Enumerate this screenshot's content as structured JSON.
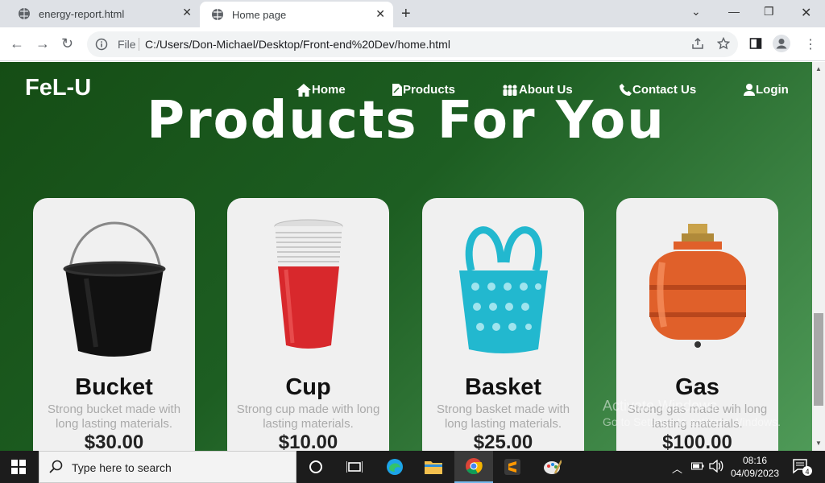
{
  "browser": {
    "tabs": [
      {
        "title": "energy-report.html",
        "active": false
      },
      {
        "title": "Home page",
        "active": true
      }
    ],
    "address": {
      "scheme_label": "File",
      "url": "C:/Users/Don-Michael/Desktop/Front-end%20Dev/home.html"
    }
  },
  "site": {
    "logo": "FeL-U",
    "nav": [
      {
        "label": "Home",
        "icon": "home-icon"
      },
      {
        "label": "Products",
        "icon": "products-icon"
      },
      {
        "label": "About Us",
        "icon": "people-icon"
      },
      {
        "label": "Contact Us",
        "icon": "phone-icon"
      },
      {
        "label": "Login",
        "icon": "user-icon"
      }
    ],
    "hero_title": "Products For You",
    "products": [
      {
        "name": "Bucket",
        "desc": "Strong bucket made with long lasting materials.",
        "price": "$30.00",
        "image": "bucket-image"
      },
      {
        "name": "Cup",
        "desc": "Strong cup made with long lasting materials.",
        "price": "$10.00",
        "image": "cup-image"
      },
      {
        "name": "Basket",
        "desc": "Strong basket made with long lasting materials.",
        "price": "$25.00",
        "image": "basket-image"
      },
      {
        "name": "Gas",
        "desc": "Strong gas made wih long lasting materials.",
        "price": "$100.00",
        "image": "gas-cylinder-image"
      }
    ],
    "colors": {
      "bg_dark": "#154d15",
      "bg_light": "#4f9a58",
      "card": "#f0f0f0"
    }
  },
  "watermark": {
    "line1": "Activate Windows",
    "line2": "Go to Settings to activate Windows."
  },
  "taskbar": {
    "search_placeholder": "Type here to search",
    "time": "08:16",
    "date": "04/09/2023",
    "notification_count": "4"
  }
}
